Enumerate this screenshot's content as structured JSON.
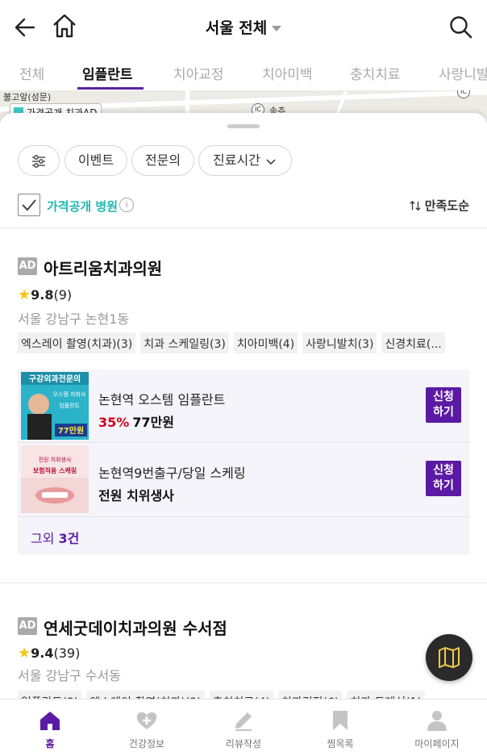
{
  "header": {
    "title": "서울 전체"
  },
  "tabs": [
    {
      "label": "전체"
    },
    {
      "label": "임플란트"
    },
    {
      "label": "치아교정"
    },
    {
      "label": "치아미백"
    },
    {
      "label": "충치치료"
    },
    {
      "label": "사랑니발"
    }
  ],
  "map": {
    "labels": [
      "불고앞(성문)",
      "송추"
    ],
    "ic_badge": "IC",
    "legend": "가격공개 치과AD"
  },
  "filters": {
    "event": "이벤트",
    "specialist": "전문의",
    "hours": "진료시간"
  },
  "price_open": {
    "label": "가격공개 병원",
    "checked": true,
    "info": "i"
  },
  "sort": {
    "label": "만족도순"
  },
  "clinics": [
    {
      "ad": "AD",
      "name": "아트리움치과의원",
      "rating": "9.8",
      "reviews": "(9)",
      "address": "서울 강남구 논현1동",
      "tags": [
        "엑스레이 촬영(치과)(3)",
        "치과 스케일링(3)",
        "치아미백(4)",
        "사랑니발치(3)",
        "신경치료(..."
      ],
      "events": [
        {
          "title": "논현역 오스템 임플란트",
          "discount": "35%",
          "price": "77만원",
          "apply": [
            "신청",
            "하기"
          ],
          "thumb": {
            "line1": "구강외과전문의",
            "line2": "오스템 자회사",
            "line3": "임플란트",
            "line4": "77만원"
          }
        },
        {
          "title": "논현역9번출구/당일 스케링",
          "discount": "",
          "price": "전원 치위생사",
          "apply": [
            "신청",
            "하기"
          ],
          "thumb": {
            "line1": "전원 치위생사",
            "line2": "보험적용 스케링"
          }
        }
      ],
      "more": {
        "prefix": "그외 ",
        "count": "3건"
      }
    },
    {
      "ad": "AD",
      "name": "연세굿데이치과의원 수서점",
      "rating": "9.4",
      "reviews": "(39)",
      "address": "서울 강남구 수서동",
      "tags": [
        "임플란트(3)",
        "엑스레이 촬영(치과)(3)",
        "충치치료(4)",
        "치과검진(6)",
        "치과 드레싱(1)"
      ]
    }
  ],
  "bottom_nav": [
    {
      "label": "홈",
      "icon": "home-icon"
    },
    {
      "label": "건강정보",
      "icon": "heart-plus-icon"
    },
    {
      "label": "리뷰작성",
      "icon": "pencil-icon"
    },
    {
      "label": "찜목록",
      "icon": "bookmark-icon"
    },
    {
      "label": "마이페이지",
      "icon": "person-icon"
    }
  ],
  "colors": {
    "brand": "#5b1aa3",
    "teal": "#1fb9b3",
    "discount": "#d0021b",
    "star": "#f5c518"
  }
}
